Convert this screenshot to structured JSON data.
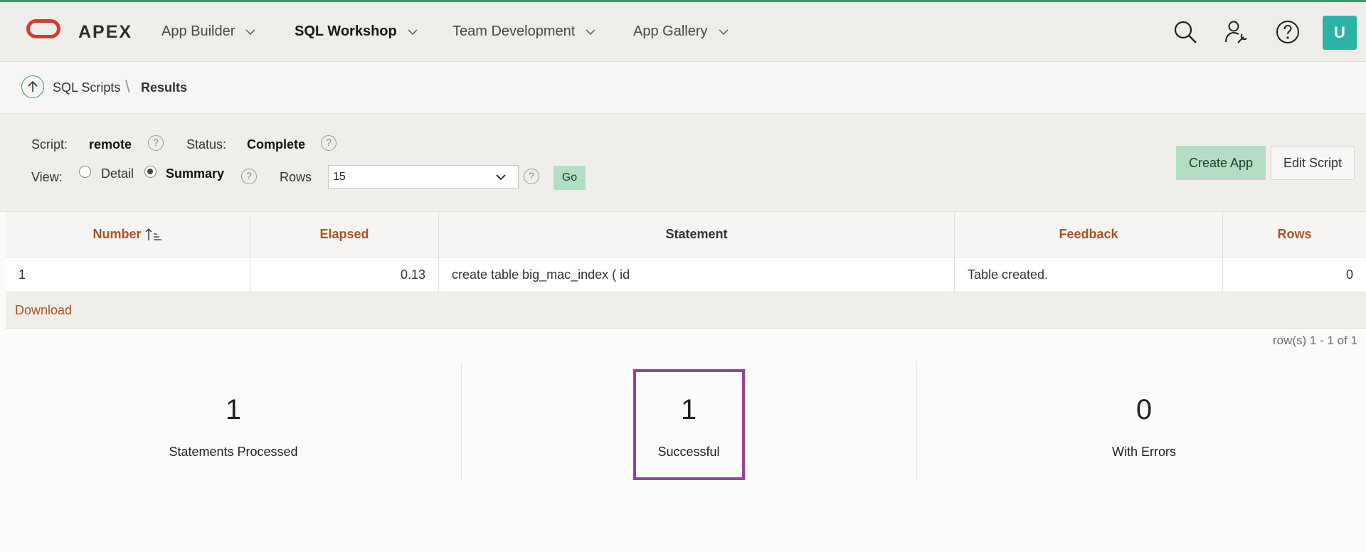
{
  "brand": {
    "name": "APEX",
    "logo_color": "#d63b31",
    "accent": "#3a9f6b"
  },
  "nav": {
    "items": [
      {
        "label": "App Builder"
      },
      {
        "label": "SQL Workshop",
        "active": true
      },
      {
        "label": "Team Development"
      },
      {
        "label": "App Gallery"
      }
    ],
    "icons": [
      "search-icon",
      "user-wrench-icon",
      "help-icon"
    ],
    "avatar": "U"
  },
  "breadcrumb": {
    "parent": "SQL Scripts",
    "current": "Results"
  },
  "filters": {
    "script_label": "Script:",
    "script_value": "remote",
    "status_label": "Status:",
    "status_value": "Complete",
    "view_label": "View:",
    "view_options": [
      "Detail",
      "Summary"
    ],
    "view_selected": "Summary",
    "rows_label": "Rows",
    "rows_value": "15",
    "go_label": "Go",
    "help_glyph": "?"
  },
  "buttons": {
    "create_app": "Create App",
    "edit_script": "Edit Script"
  },
  "table": {
    "columns": [
      "Number",
      "Elapsed",
      "Statement",
      "Feedback",
      "Rows"
    ],
    "rows": [
      {
        "number": "1",
        "elapsed": "0.13",
        "statement": "create table big_mac_index ( id",
        "feedback": "Table created.",
        "rows": "0"
      }
    ],
    "download": "Download",
    "pagination": "row(s) 1 - 1 of 1"
  },
  "summary": [
    {
      "value": "1",
      "label": "Statements Processed"
    },
    {
      "value": "1",
      "label": "Successful"
    },
    {
      "value": "0",
      "label": "With Errors"
    }
  ]
}
